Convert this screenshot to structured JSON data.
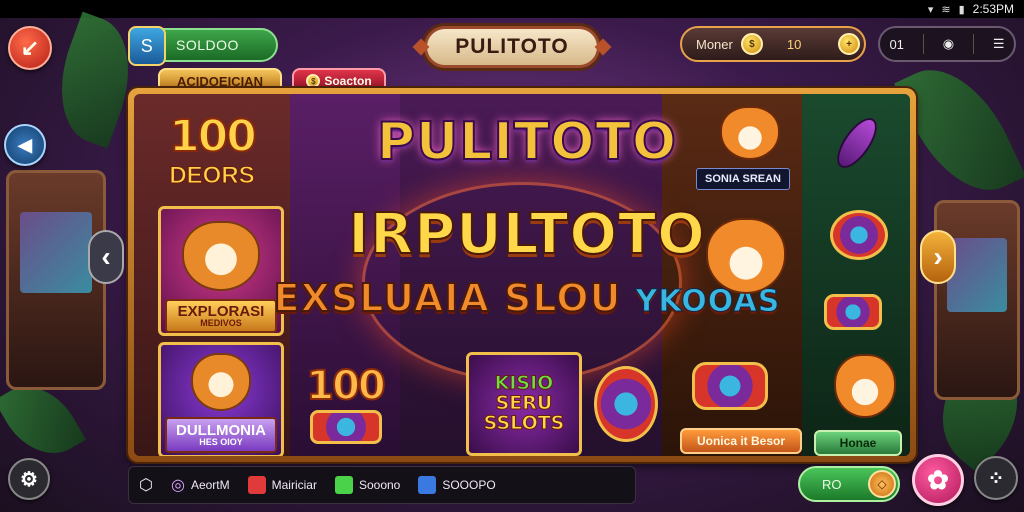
{
  "status_bar": {
    "time": "2:53PM",
    "icons": [
      "wifi-icon",
      "signal-icon",
      "battery-icon"
    ]
  },
  "header": {
    "balance": {
      "label": "SOLDOO",
      "icon": "shield-s-icon"
    },
    "logo_text": "PULITOTO",
    "money": {
      "label": "Moner",
      "amount": "10"
    },
    "menu": {
      "left_label": "01",
      "items": [
        "settings-icon",
        "hamburger-icon"
      ]
    }
  },
  "tabs": [
    {
      "label": "ACIDOEICIAN",
      "active": true
    },
    {
      "label": "Soacton",
      "active": false
    }
  ],
  "reels": {
    "col1": {
      "top_value": "100",
      "top_label": "DEORS",
      "card1_title": "EXPLORASI",
      "card1_sub": "MEDIVOS",
      "card2_title": "DULLMONIA",
      "card2_sub": "HES OIOY"
    },
    "col2": {
      "value": "100"
    },
    "headline": {
      "line1": "PULITOTO",
      "line2": "IRPULTOTO",
      "line3_main": "EXSLUAIA SLOU",
      "line3_tail": "YKOOAS"
    },
    "promo_box": [
      "KISIO",
      "SERU",
      "SSLOTS"
    ],
    "col4": {
      "badge": "SONIA SREAN"
    },
    "col5": {},
    "buttons": {
      "orange": "Uonica it Besor",
      "green": "Honae"
    }
  },
  "bottom_bar": {
    "items": [
      {
        "icon": "box-icon",
        "label": ""
      },
      {
        "icon": "account-icon",
        "label": "AeortM"
      },
      {
        "icon": "gift-icon",
        "label": "Mairiciar"
      },
      {
        "icon": "green-cube-icon",
        "label": "Sooono"
      },
      {
        "icon": "blue-cube-icon",
        "label": "SOOOPO"
      }
    ],
    "ro_pill": "RO"
  },
  "colors": {
    "accent_gold": "#f2c04a",
    "brand_green": "#3ea54a",
    "spin_pink": "#e03a7a"
  }
}
